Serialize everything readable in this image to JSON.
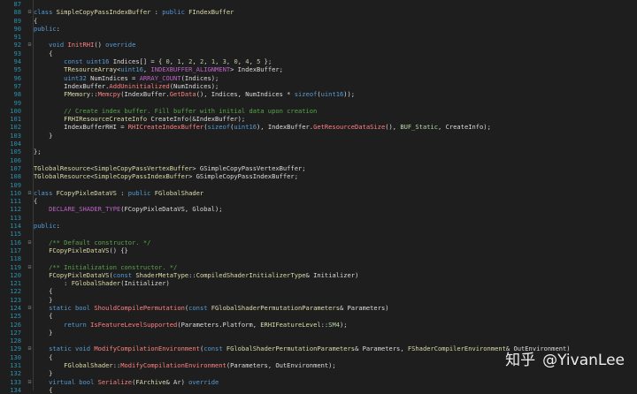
{
  "editor": {
    "lines": [
      {
        "n": "87",
        "f": "",
        "t": []
      },
      {
        "n": "88",
        "f": "⊟",
        "t": [
          [
            "kw",
            "class "
          ],
          [
            "type",
            "SimpleCopyPassIndexBuffer"
          ],
          [
            "plain",
            " : "
          ],
          [
            "kw",
            "public "
          ],
          [
            "type",
            "FIndexBuffer"
          ]
        ]
      },
      {
        "n": "89",
        "f": "",
        "t": [
          [
            "plain",
            "{"
          ]
        ]
      },
      {
        "n": "90",
        "f": "",
        "t": [
          [
            "kw",
            "public"
          ],
          [
            "plain",
            ":"
          ]
        ]
      },
      {
        "n": "91",
        "f": "",
        "t": []
      },
      {
        "n": "92",
        "f": "⊟",
        "t": [
          [
            "plain",
            "    "
          ],
          [
            "kw",
            "void "
          ],
          [
            "fn",
            "InitRHI"
          ],
          [
            "plain",
            "() "
          ],
          [
            "kw",
            "override"
          ]
        ]
      },
      {
        "n": "93",
        "f": "",
        "t": [
          [
            "plain",
            "    {"
          ]
        ]
      },
      {
        "n": "94",
        "f": "",
        "t": [
          [
            "plain",
            "        "
          ],
          [
            "kw",
            "const "
          ],
          [
            "kw",
            "uint16 "
          ],
          [
            "plain",
            "Indices[] = { "
          ],
          [
            "num",
            "0"
          ],
          [
            "plain",
            ", "
          ],
          [
            "num",
            "1"
          ],
          [
            "plain",
            ", "
          ],
          [
            "num",
            "2"
          ],
          [
            "plain",
            ", "
          ],
          [
            "num",
            "2"
          ],
          [
            "plain",
            ", "
          ],
          [
            "num",
            "1"
          ],
          [
            "plain",
            ", "
          ],
          [
            "num",
            "3"
          ],
          [
            "plain",
            ", "
          ],
          [
            "num",
            "0"
          ],
          [
            "plain",
            ", "
          ],
          [
            "num",
            "4"
          ],
          [
            "plain",
            ", "
          ],
          [
            "num",
            "5"
          ],
          [
            "plain",
            " };"
          ]
        ]
      },
      {
        "n": "95",
        "f": "",
        "t": [
          [
            "plain",
            "        "
          ],
          [
            "type",
            "TResourceArray"
          ],
          [
            "plain",
            "<"
          ],
          [
            "kw",
            "uint16"
          ],
          [
            "plain",
            ", "
          ],
          [
            "macro",
            "INDEXBUFFER_ALIGNMENT"
          ],
          [
            "plain",
            "> IndexBuffer;"
          ]
        ]
      },
      {
        "n": "96",
        "f": "",
        "t": [
          [
            "plain",
            "        "
          ],
          [
            "kw",
            "uint32 "
          ],
          [
            "plain",
            "NumIndices = "
          ],
          [
            "macro",
            "ARRAY_COUNT"
          ],
          [
            "plain",
            "(Indices);"
          ]
        ]
      },
      {
        "n": "97",
        "f": "",
        "t": [
          [
            "plain",
            "        IndexBuffer."
          ],
          [
            "fn",
            "AddUninitialized"
          ],
          [
            "plain",
            "(NumIndices);"
          ]
        ]
      },
      {
        "n": "98",
        "f": "",
        "t": [
          [
            "plain",
            "        "
          ],
          [
            "type",
            "FMemory"
          ],
          [
            "plain",
            "::"
          ],
          [
            "fn",
            "Memcpy"
          ],
          [
            "plain",
            "(IndexBuffer."
          ],
          [
            "fn",
            "GetData"
          ],
          [
            "plain",
            "(), Indices, NumIndices * "
          ],
          [
            "kw",
            "sizeof"
          ],
          [
            "plain",
            "("
          ],
          [
            "kw",
            "uint16"
          ],
          [
            "plain",
            "));"
          ]
        ]
      },
      {
        "n": "99",
        "f": "",
        "t": []
      },
      {
        "n": "100",
        "f": "",
        "t": [
          [
            "plain",
            "        "
          ],
          [
            "com",
            "// Create index buffer. Fill buffer with initial data upon creation"
          ]
        ]
      },
      {
        "n": "101",
        "f": "",
        "t": [
          [
            "plain",
            "        "
          ],
          [
            "type",
            "FRHIResourceCreateInfo "
          ],
          [
            "plain",
            "CreateInfo(&IndexBuffer);"
          ]
        ]
      },
      {
        "n": "102",
        "f": "",
        "t": [
          [
            "plain",
            "        IndexBufferRHI = "
          ],
          [
            "fn",
            "RHICreateIndexBuffer"
          ],
          [
            "plain",
            "("
          ],
          [
            "kw",
            "sizeof"
          ],
          [
            "plain",
            "("
          ],
          [
            "kw",
            "uint16"
          ],
          [
            "plain",
            "), IndexBuffer."
          ],
          [
            "fn",
            "GetResourceDataSize"
          ],
          [
            "plain",
            "(), "
          ],
          [
            "enum",
            "BUF_Static"
          ],
          [
            "plain",
            ", CreateInfo);"
          ]
        ]
      },
      {
        "n": "103",
        "f": "",
        "t": [
          [
            "plain",
            "    }"
          ]
        ]
      },
      {
        "n": "104",
        "f": "",
        "t": []
      },
      {
        "n": "105",
        "f": "",
        "t": [
          [
            "plain",
            "};"
          ]
        ]
      },
      {
        "n": "106",
        "f": "",
        "t": []
      },
      {
        "n": "107",
        "f": "",
        "t": [
          [
            "type",
            "TGlobalResource"
          ],
          [
            "plain",
            "<"
          ],
          [
            "type",
            "SimpleCopyPassVertexBuffer"
          ],
          [
            "plain",
            "> GSimpleCopyPassVertexBuffer;"
          ]
        ]
      },
      {
        "n": "108",
        "f": "",
        "t": [
          [
            "type",
            "TGlobalResource"
          ],
          [
            "plain",
            "<"
          ],
          [
            "type",
            "SimpleCopyPassIndexBuffer"
          ],
          [
            "plain",
            "> GSimpleCopyPassIndexBuffer;"
          ]
        ]
      },
      {
        "n": "109",
        "f": "",
        "t": []
      },
      {
        "n": "110",
        "f": "⊟",
        "t": [
          [
            "kw",
            "class "
          ],
          [
            "type",
            "FCopyPixleDataVS"
          ],
          [
            "plain",
            " : "
          ],
          [
            "kw",
            "public "
          ],
          [
            "type",
            "FGlobalShader"
          ]
        ]
      },
      {
        "n": "111",
        "f": "",
        "t": [
          [
            "plain",
            "{"
          ]
        ]
      },
      {
        "n": "112",
        "f": "",
        "t": [
          [
            "plain",
            "    "
          ],
          [
            "macro",
            "DECLARE_SHADER_TYPE"
          ],
          [
            "plain",
            "(FCopyPixleDataVS, Global);"
          ]
        ]
      },
      {
        "n": "113",
        "f": "",
        "t": []
      },
      {
        "n": "114",
        "f": "",
        "t": [
          [
            "kw",
            "public"
          ],
          [
            "plain",
            ":"
          ]
        ]
      },
      {
        "n": "115",
        "f": "",
        "t": []
      },
      {
        "n": "116",
        "f": "⊟",
        "t": [
          [
            "plain",
            "    "
          ],
          [
            "com",
            "/** Default constructor. */"
          ]
        ]
      },
      {
        "n": "117",
        "f": "",
        "t": [
          [
            "plain",
            "    "
          ],
          [
            "type",
            "FCopyPixleDataVS"
          ],
          [
            "plain",
            "() {}"
          ]
        ]
      },
      {
        "n": "118",
        "f": "",
        "t": []
      },
      {
        "n": "119",
        "f": "⊟",
        "t": [
          [
            "plain",
            "    "
          ],
          [
            "com",
            "/** Initialization constructor. */"
          ]
        ]
      },
      {
        "n": "120",
        "f": "",
        "t": [
          [
            "plain",
            "    "
          ],
          [
            "type",
            "FCopyPixleDataVS"
          ],
          [
            "plain",
            "("
          ],
          [
            "kw",
            "const "
          ],
          [
            "type",
            "ShaderMetaType"
          ],
          [
            "plain",
            "::"
          ],
          [
            "type",
            "CompiledShaderInitializerType"
          ],
          [
            "plain",
            "& Initializer)"
          ]
        ]
      },
      {
        "n": "121",
        "f": "",
        "t": [
          [
            "plain",
            "        : "
          ],
          [
            "type",
            "FGlobalShader"
          ],
          [
            "plain",
            "(Initializer)"
          ]
        ]
      },
      {
        "n": "122",
        "f": "",
        "t": [
          [
            "plain",
            "    {"
          ]
        ]
      },
      {
        "n": "123",
        "f": "",
        "t": [
          [
            "plain",
            "    }"
          ]
        ]
      },
      {
        "n": "124",
        "f": "⊟",
        "t": [
          [
            "plain",
            "    "
          ],
          [
            "kw",
            "static "
          ],
          [
            "kw",
            "bool "
          ],
          [
            "fn",
            "ShouldCompilePermutation"
          ],
          [
            "plain",
            "("
          ],
          [
            "kw",
            "const "
          ],
          [
            "type",
            "FGlobalShaderPermutationParameters"
          ],
          [
            "plain",
            "& Parameters)"
          ]
        ]
      },
      {
        "n": "125",
        "f": "",
        "t": [
          [
            "plain",
            "    {"
          ]
        ]
      },
      {
        "n": "126",
        "f": "",
        "t": [
          [
            "plain",
            "        "
          ],
          [
            "kw",
            "return "
          ],
          [
            "fn",
            "IsFeatureLevelSupported"
          ],
          [
            "plain",
            "(Parameters.Platform, "
          ],
          [
            "type",
            "ERHIFeatureLevel"
          ],
          [
            "plain",
            "::"
          ],
          [
            "enum",
            "SM4"
          ],
          [
            "plain",
            ");"
          ]
        ]
      },
      {
        "n": "127",
        "f": "",
        "t": [
          [
            "plain",
            "    }"
          ]
        ]
      },
      {
        "n": "128",
        "f": "",
        "t": []
      },
      {
        "n": "129",
        "f": "⊟",
        "t": [
          [
            "plain",
            "    "
          ],
          [
            "kw",
            "static "
          ],
          [
            "kw",
            "void "
          ],
          [
            "fn",
            "ModifyCompilationEnvironment"
          ],
          [
            "plain",
            "("
          ],
          [
            "kw",
            "const "
          ],
          [
            "type",
            "FGlobalShaderPermutationParameters"
          ],
          [
            "plain",
            "& Parameters, "
          ],
          [
            "type",
            "FShaderCompilerEnvironment"
          ],
          [
            "plain",
            "& OutEnvironment)"
          ]
        ]
      },
      {
        "n": "130",
        "f": "",
        "t": [
          [
            "plain",
            "    {"
          ]
        ]
      },
      {
        "n": "131",
        "f": "",
        "t": [
          [
            "plain",
            "        "
          ],
          [
            "type",
            "FGlobalShader"
          ],
          [
            "plain",
            "::"
          ],
          [
            "fn",
            "ModifyCompilationEnvironment"
          ],
          [
            "plain",
            "(Parameters, OutEnvironment);"
          ]
        ]
      },
      {
        "n": "132",
        "f": "",
        "t": [
          [
            "plain",
            "    }"
          ]
        ]
      },
      {
        "n": "133",
        "f": "⊟",
        "t": [
          [
            "plain",
            "    "
          ],
          [
            "kw",
            "virtual "
          ],
          [
            "kw",
            "bool "
          ],
          [
            "fn",
            "Serialize"
          ],
          [
            "plain",
            "("
          ],
          [
            "type",
            "FArchive"
          ],
          [
            "plain",
            "& Ar) "
          ],
          [
            "kw",
            "override"
          ]
        ]
      },
      {
        "n": "134",
        "f": "",
        "t": [
          [
            "plain",
            "    {"
          ]
        ]
      }
    ]
  },
  "watermark": {
    "cn": "知乎",
    "handle": "@YivanLee"
  }
}
